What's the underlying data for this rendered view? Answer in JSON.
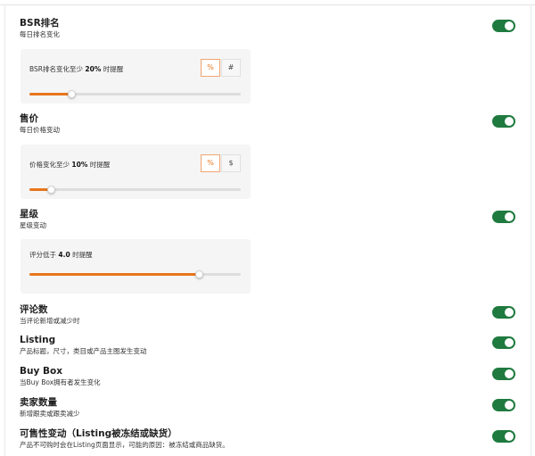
{
  "accent_color": "#e8761c",
  "toggle_color": "#1f7a3f",
  "bsr": {
    "title": "BSR排名",
    "desc": "每日排名变化",
    "enabled": true,
    "slider_prefix": "BSR排名变化至少",
    "slider_value": "20%",
    "slider_suffix": "时提醒",
    "unit_options": [
      "%",
      "#"
    ],
    "unit_selected": "%",
    "slider_level": 0.2
  },
  "price": {
    "title": "售价",
    "desc": "每日价格变动",
    "enabled": true,
    "slider_prefix": "价格变化至少",
    "slider_value": "10%",
    "slider_suffix": "时提醒",
    "unit_options": [
      "%",
      "$"
    ],
    "unit_selected": "%",
    "slider_level": 0.1
  },
  "rating": {
    "title": "星级",
    "desc": "星级变动",
    "enabled": true,
    "slider_prefix": "评分低于",
    "slider_value": "4.0",
    "slider_suffix": "时提醒",
    "slider_level": 0.8
  },
  "reviews": {
    "title": "评论数",
    "desc": "当评论新增或减少时",
    "enabled": true
  },
  "listing": {
    "title": "Listing",
    "desc": "产品标题，尺寸，类目或产品主图发生变动",
    "enabled": true
  },
  "buybox": {
    "title": "Buy Box",
    "desc": "当Buy Box拥有者发生变化",
    "enabled": true
  },
  "sellers": {
    "title": "卖家数量",
    "desc": "新增跟卖或跟卖减少",
    "enabled": true
  },
  "availability": {
    "title": "可售性变动（Listing被冻结或缺货）",
    "desc": "产品不可购时会在Listing页面显示，可能的原因：被冻结或商品缺货。",
    "enabled": true
  }
}
